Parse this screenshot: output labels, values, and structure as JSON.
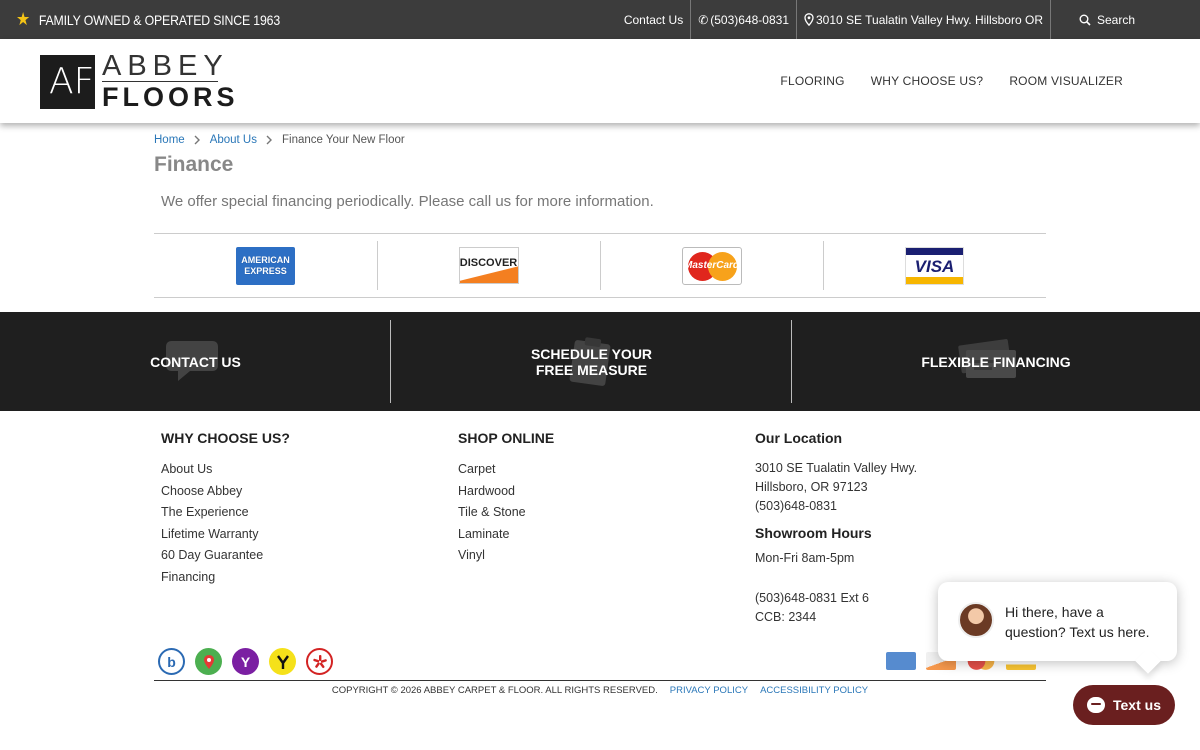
{
  "topbar": {
    "tagline": "FAMILY OWNED & OPERATED SINCE 1963",
    "contact": "Contact Us",
    "phone": "(503)648-0831",
    "address": "3010 SE Tualatin Valley Hwy. Hillsboro OR",
    "search": "Search"
  },
  "logo": {
    "mark": "AF",
    "line1": "ABBEY",
    "line2": "FLOORS"
  },
  "nav": {
    "items": [
      "FLOORING",
      "WHY CHOOSE US?",
      "ROOM VISUALIZER"
    ]
  },
  "breadcrumb": {
    "home": "Home",
    "about": "About Us",
    "current": "Finance Your New Floor"
  },
  "page": {
    "title": "Finance",
    "intro": "We offer special financing periodically. Please call us for more information."
  },
  "payment_cards": {
    "amex_line1": "AMERICAN",
    "amex_line2": "EXPRESS",
    "discover": "DISCOVER",
    "mastercard": "MasterCard",
    "visa": "VISA"
  },
  "cta_band": {
    "contact": "CONTACT US",
    "schedule_line1": "SCHEDULE YOUR",
    "schedule_line2": "FREE MEASURE",
    "financing": "FLEXIBLE FINANCING"
  },
  "footer": {
    "col1": {
      "title": "WHY CHOOSE US?",
      "items": [
        "About Us",
        "Choose Abbey",
        "The Experience",
        "Lifetime Warranty",
        "60 Day Guarantee",
        "Financing"
      ]
    },
    "col2": {
      "title": "SHOP ONLINE",
      "items": [
        "Carpet",
        "Hardwood",
        "Tile & Stone",
        "Laminate",
        "Vinyl"
      ]
    },
    "col3": {
      "title": "Our Location",
      "address1": "3010 SE Tualatin Valley Hwy.",
      "address2": "Hillsboro, OR 97123",
      "phone": "(503)648-0831",
      "hours_title": "Showroom Hours",
      "hours": "Mon-Fri 8am-5pm",
      "ext": "(503)648-0831 Ext 6",
      "ccb": "CCB: 2344"
    },
    "copyright": "COPYRIGHT © 2026 ABBEY CARPET & FLOOR. ALL RIGHTS RESERVED.",
    "privacy": "PRIVACY POLICY",
    "accessibility": "ACCESSIBILITY POLICY"
  },
  "chat": {
    "message_line1": "Hi there, have a",
    "message_line2": "question? Text us here.",
    "button": "Text us"
  },
  "colors": {
    "topbar": "#3c3c3c",
    "band": "#1f1f1f",
    "link": "#2a77b8",
    "chat_button": "#6a1f1f",
    "star": "#f3c316"
  }
}
